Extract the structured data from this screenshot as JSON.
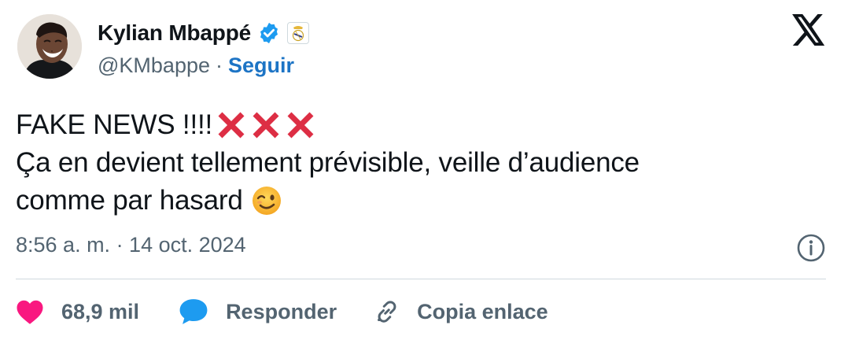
{
  "author": {
    "name": "Kylian Mbappé",
    "handle": "@KMbappe",
    "separator": "·",
    "follow_label": "Seguir"
  },
  "tweet": {
    "line1": "FAKE NEWS !!!!",
    "line2": "Ça en devient tellement prévisible, veille d’audience",
    "line3": "comme par hasard",
    "emojis": [
      "cross-mark",
      "cross-mark",
      "cross-mark",
      "winking-face"
    ]
  },
  "timestamp": "8:56 a. m. · 14 oct. 2024",
  "actions": {
    "likes": "68,9 mil",
    "reply_label": "Responder",
    "copy_label": "Copia enlace"
  },
  "colors": {
    "like": "#f91880",
    "reply": "#1d9bf0",
    "link": "#1d74c5",
    "verified": "#1d9bf0",
    "cross": "#dd2e44",
    "muted": "#536471"
  }
}
